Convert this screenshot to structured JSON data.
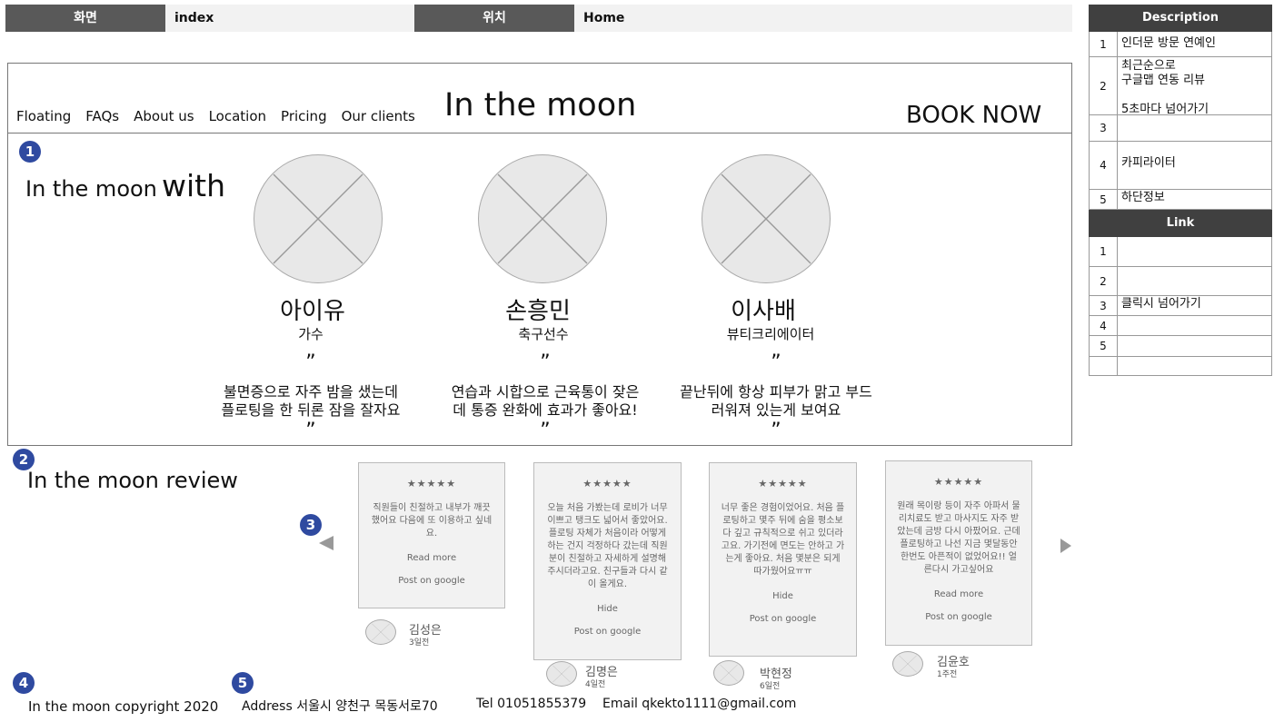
{
  "topbar": {
    "screen_label": "화면",
    "screen_value": "index",
    "location_label": "위치",
    "location_value": "Home"
  },
  "site": {
    "title": "In the moon",
    "book_now": "BOOK NOW",
    "nav": [
      "Floating",
      "FAQs",
      "About us",
      "Location",
      "Pricing",
      "Our clients"
    ]
  },
  "section1": {
    "marker": "1",
    "heading_main": "In the moon",
    "heading_accent": "with",
    "people": [
      {
        "name": "아이유",
        "role": "가수",
        "quote_line1": "불면증으로 자주 밤을 샜는데",
        "quote_line2": "플로팅을 한 뒤론 잠을 잘자요"
      },
      {
        "name": "손흥민",
        "role": "축구선수",
        "quote_line1": "연습과 시합으로 근육통이 잦은",
        "quote_line2": "데 통증 완화에 효과가 좋아요!"
      },
      {
        "name": "이사배",
        "role": "뷰티크리에이터",
        "quote_line1": "끝난뒤에 항상 피부가 맑고 부드",
        "quote_line2": "러워져 있는게 보여요"
      }
    ],
    "quote_open": "”",
    "quote_close": "”"
  },
  "section2": {
    "marker": "2",
    "heading": "In the moon review",
    "carousel_marker": "3",
    "reviews": [
      {
        "stars": "★★★★★",
        "text": "직원들이 친절하고 내부가 깨끗했어요 다음에 또 이용하고 싶네요.",
        "action": "Read more",
        "post": "Post on google",
        "name": "김성은",
        "time": "3일전"
      },
      {
        "stars": "★★★★★",
        "text": "오늘 처음 가봤는데 로비가 너무 이쁘고 탱크도 넓어서 좋았어요. 플로팅 자체가 처음이라 어떻게 하는 건지 걱정하다 갔는데 직원분이 친절하고 자세하게 설명해 주시더라고요. 친구들과 다시 같이 올게요.",
        "action": "Hide",
        "post": "Post on google",
        "name": "김명은",
        "time": "4일전"
      },
      {
        "stars": "★★★★★",
        "text": "너무 좋은 경험이었어요. 처음 플로팅하고 몇주 뒤에 숨을 평소보다 깊고 규칙적으로 쉬고 있더라고요. 가기전에 면도는 안하고 가는게 좋아요. 처음 몇분은 되게 따가웠어요ㅠㅠ",
        "action": "Hide",
        "post": "Post on google",
        "name": "박현정",
        "time": "6일전"
      },
      {
        "stars": "★★★★★",
        "text": "원래 목이랑 등이 자주 아파서 물리치료도 받고 마사지도 자주 받았는데 금방 다시 아팠어요. 근데 플로팅하고 나선 지금 몇달동안 한번도 아픈적이 없었어요!! 얼른다시 가고싶어요",
        "action": "Read more",
        "post": "Post on google",
        "name": "김윤호",
        "time": "1주전"
      }
    ]
  },
  "footer": {
    "marker4": "4",
    "marker5": "5",
    "copyright": "In the moon copyright 2020",
    "address": "Address 서울시 양천구 목동서로70",
    "tel": "Tel 01051855379",
    "email": "Email qkekto1111@gmail.com"
  },
  "panel": {
    "description_title": "Description",
    "description": [
      {
        "n": "1",
        "text": "인더문 방문 연예인"
      },
      {
        "n": "2",
        "text": "최근순으로\n구글맵 연동 리뷰\n\n 5초마다 넘어가기"
      },
      {
        "n": "3",
        "text": ""
      },
      {
        "n": "4",
        "text": "카피라이터"
      },
      {
        "n": "5",
        "text": "하단정보"
      }
    ],
    "link_title": "Link",
    "links": [
      {
        "n": "1",
        "text": ""
      },
      {
        "n": "2",
        "text": ""
      },
      {
        "n": "3",
        "text": "클릭시 넘어가기"
      },
      {
        "n": "4",
        "text": ""
      },
      {
        "n": "5",
        "text": ""
      },
      {
        "n": "",
        "text": ""
      }
    ]
  }
}
